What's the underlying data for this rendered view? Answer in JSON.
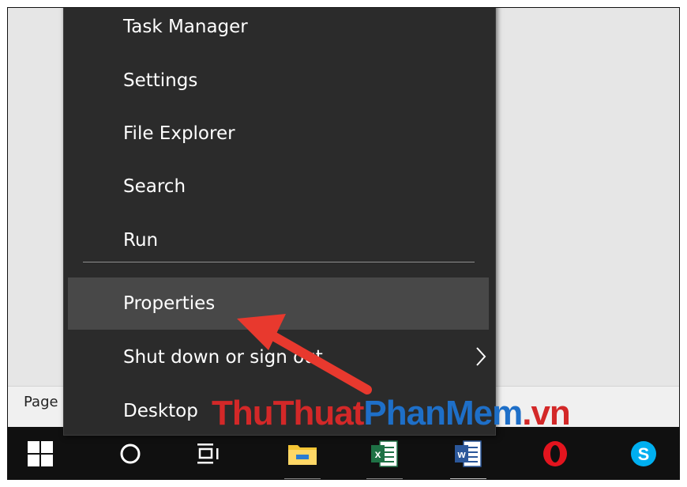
{
  "menu": {
    "items": [
      {
        "label": "Task Manager"
      },
      {
        "label": "Settings"
      },
      {
        "label": "File Explorer"
      },
      {
        "label": "Search"
      },
      {
        "label": "Run"
      },
      {
        "label": "Properties"
      },
      {
        "label": "Shut down or sign out"
      },
      {
        "label": "Desktop"
      }
    ],
    "highlighted_item": "Properties"
  },
  "status_bar": {
    "text": "Page"
  },
  "taskbar": {
    "icons": [
      "windows-start-icon",
      "cortana-circle-icon",
      "task-view-icon",
      "file-explorer-icon",
      "excel-icon",
      "word-icon",
      "opera-icon",
      "skype-icon"
    ],
    "open_apps": [
      "file-explorer-icon",
      "excel-icon",
      "word-icon"
    ],
    "active_app": "word-icon"
  },
  "watermark": {
    "part1": "ThuThuat",
    "part2": "PhanMem",
    "part3": ".vn"
  },
  "colors": {
    "menu_bg": "#2b2b2b",
    "menu_highlight": "#484848",
    "arrow": "#e8392e",
    "taskbar": "#101010"
  }
}
